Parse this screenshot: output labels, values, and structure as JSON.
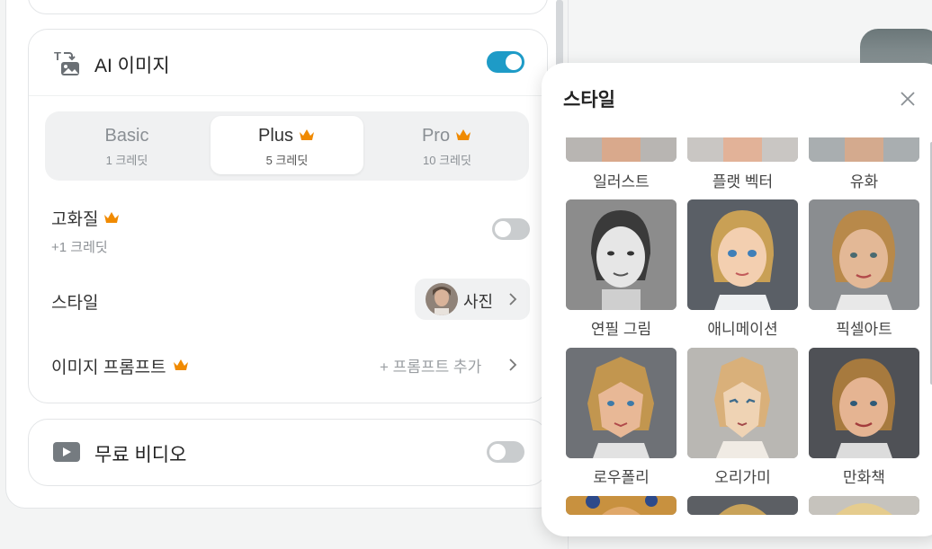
{
  "ai_image": {
    "title": "AI 이미지",
    "toggle_on": true,
    "tiers": [
      {
        "name": "Basic",
        "credits": "1 크레딧",
        "premium": false,
        "active": false
      },
      {
        "name": "Plus",
        "credits": "5 크레딧",
        "premium": true,
        "active": true
      },
      {
        "name": "Pro",
        "credits": "10 크레딧",
        "premium": true,
        "active": false
      }
    ],
    "hd": {
      "label": "고화질",
      "credit": "+1 크레딧",
      "toggle_on": false
    },
    "style": {
      "label": "스타일",
      "value": "사진"
    },
    "prompt": {
      "label": "이미지 프롬프트",
      "action": "+ 프롬프트 추가"
    }
  },
  "video": {
    "title": "무료 비디오",
    "toggle_on": false
  },
  "style_popup": {
    "title": "스타일",
    "items": [
      {
        "label": "일러스트",
        "icon": "illustration-thumb"
      },
      {
        "label": "플랫 벡터",
        "icon": "flat-vector-thumb"
      },
      {
        "label": "유화",
        "icon": "oil-painting-thumb"
      },
      {
        "label": "연필 그림",
        "icon": "pencil-drawing-thumb"
      },
      {
        "label": "애니메이션",
        "icon": "animation-thumb"
      },
      {
        "label": "픽셀아트",
        "icon": "pixel-art-thumb"
      },
      {
        "label": "로우폴리",
        "icon": "low-poly-thumb"
      },
      {
        "label": "오리가미",
        "icon": "origami-thumb"
      },
      {
        "label": "만화책",
        "icon": "comic-book-thumb"
      }
    ]
  },
  "colors": {
    "accent": "#1e9bc7",
    "crown": "#f08a00",
    "toggle_off": "#c9ccce"
  }
}
